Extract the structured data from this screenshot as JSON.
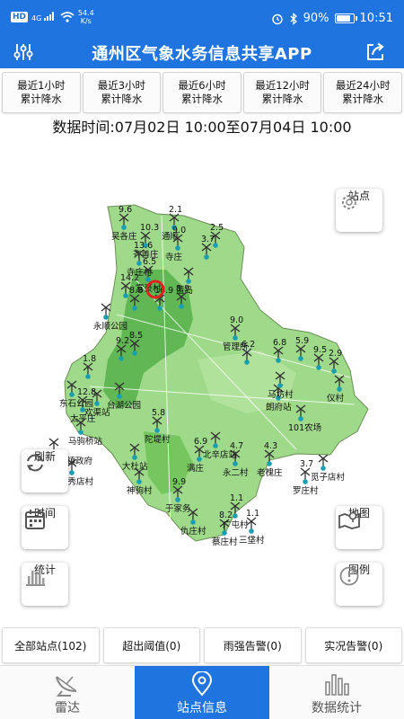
{
  "status": {
    "hd": "HD",
    "signal": "4G",
    "speed_value": "54.4",
    "speed_unit": "K/s",
    "battery": "90%",
    "battery_level": 0.9,
    "time": "10:51"
  },
  "app": {
    "title": "通州区气象水务信息共享APP"
  },
  "chips": [
    {
      "line1": "最近1小时",
      "line2": "累计降水"
    },
    {
      "line1": "最近3小时",
      "line2": "累计降水"
    },
    {
      "line1": "最近6小时",
      "line2": "累计降水"
    },
    {
      "line1": "最近12小时",
      "line2": "累计降水"
    },
    {
      "line1": "最近24小时",
      "line2": "累计降水"
    }
  ],
  "data_time": "数据时间:07月02日 10:00至07月04日 10:00",
  "map": {
    "stations": [
      {
        "name": "吴各庄",
        "value": "9.6"
      },
      {
        "name": "通顺",
        "value": "2.1"
      },
      {
        "name": "寺庄",
        "value": "9.0"
      },
      {
        "name": "",
        "value": "2.5"
      },
      {
        "name": "",
        "value": "3.7"
      },
      {
        "name": "齐善庄",
        "value": "10.3"
      },
      {
        "name": "寺庄村",
        "value": "13.6"
      },
      {
        "name": "蓝岛",
        "value": ""
      },
      {
        "name": "富豪村",
        "value": "6.5"
      },
      {
        "name": "",
        "value": "14.2"
      },
      {
        "name": "",
        "value": "8.8"
      },
      {
        "name": "",
        "value": "16.9"
      },
      {
        "name": "",
        "value": "8.9"
      },
      {
        "name": "永顺公园",
        "value": ""
      },
      {
        "name": "管理所",
        "value": "9.0"
      },
      {
        "name": "",
        "value": "8.5"
      },
      {
        "name": "",
        "value": "9.2"
      },
      {
        "name": "",
        "value": "6.8"
      },
      {
        "name": "",
        "value": "6.2"
      },
      {
        "name": "",
        "value": "5.9"
      },
      {
        "name": "",
        "value": "9.5"
      },
      {
        "name": "",
        "value": "2.9"
      },
      {
        "name": "",
        "value": "1.8"
      },
      {
        "name": "东石公园",
        "value": ""
      },
      {
        "name": "欢渠站",
        "value": ""
      },
      {
        "name": "太平庄",
        "value": "12.8"
      },
      {
        "name": "台湖公园",
        "value": ""
      },
      {
        "name": "马驹桥站",
        "value": ""
      },
      {
        "name": "马驹桥镇政府",
        "value": ""
      },
      {
        "name": "杨秀店村",
        "value": ""
      },
      {
        "name": "陀堤村",
        "value": "5.8"
      },
      {
        "name": "大杜站",
        "value": ""
      },
      {
        "name": "神驹村",
        "value": ""
      },
      {
        "name": "满庄",
        "value": "6.9"
      },
      {
        "name": "永二村",
        "value": "4.7"
      },
      {
        "name": "老槐庄",
        "value": "4.3"
      },
      {
        "name": "罗庄村",
        "value": "3.7"
      },
      {
        "name": "仇庄村",
        "value": ""
      },
      {
        "name": "蔡庄村",
        "value": "8.2"
      },
      {
        "name": "三垡村",
        "value": "1.1"
      },
      {
        "name": "觅子店村",
        "value": ""
      },
      {
        "name": "101农场",
        "value": ""
      },
      {
        "name": "朗府站",
        "value": ""
      },
      {
        "name": "马坊村",
        "value": ""
      },
      {
        "name": "仪村",
        "value": ""
      },
      {
        "name": "于家务",
        "value": "9.9"
      },
      {
        "name": "北辛店站",
        "value": ""
      },
      {
        "name": "广屯村",
        "value": "1.1"
      }
    ]
  },
  "buttons": {
    "station": "站点",
    "refresh": "刷新",
    "time": "时间",
    "stats": "统计",
    "map": "地图",
    "legend": "图例"
  },
  "bottom_stats": [
    {
      "label": "全部站点(102)"
    },
    {
      "label": "超出阈值(0)"
    },
    {
      "label": "雨强告警(0)"
    },
    {
      "label": "实况告警(0)"
    }
  ],
  "nav": [
    {
      "label": "雷达"
    },
    {
      "label": "站点信息"
    },
    {
      "label": "数据统计"
    }
  ]
}
